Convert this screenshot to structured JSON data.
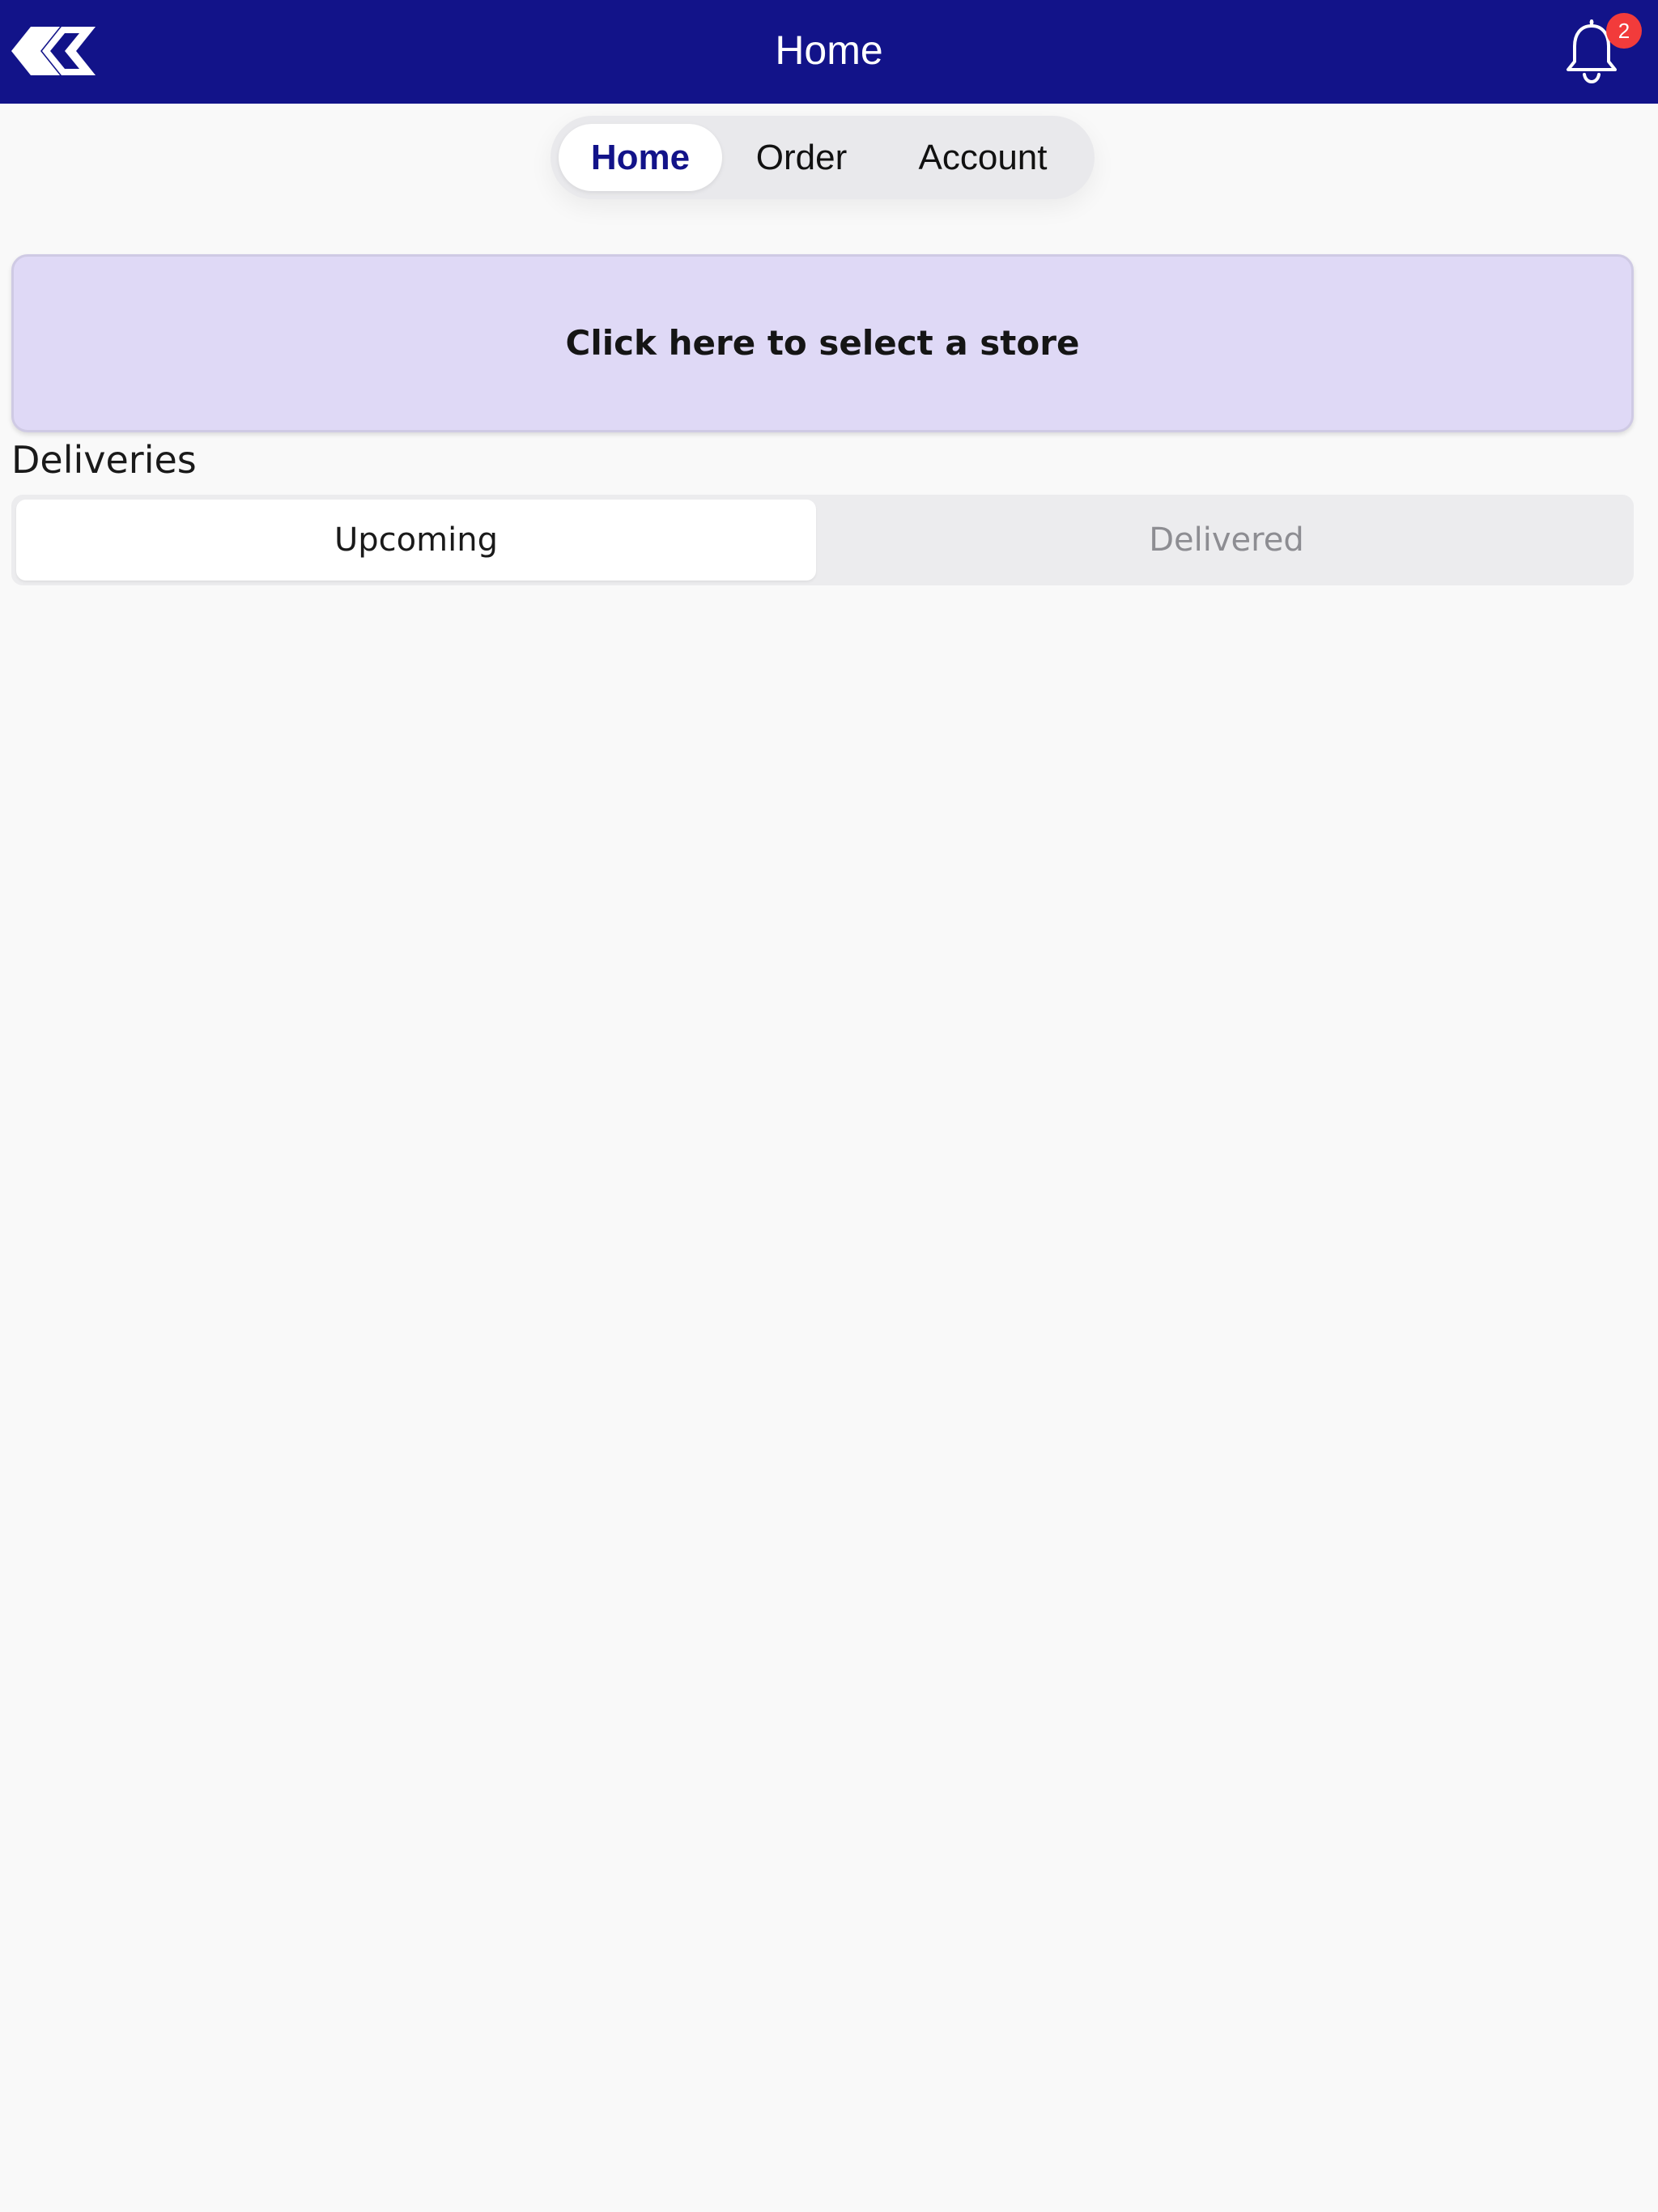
{
  "header": {
    "title": "Home",
    "logo_icon": "logo-icon",
    "bell_icon": "bell-icon",
    "notification_count": "2",
    "background_color": "#121389",
    "badge_color": "#f23b3b"
  },
  "nav_tabs": {
    "items": [
      {
        "label": "Home",
        "selected": true
      },
      {
        "label": "Order",
        "selected": false
      },
      {
        "label": "Account",
        "selected": false
      }
    ],
    "selected_color": "#121389"
  },
  "store_selector": {
    "label": "Click here to select a store",
    "background_color": "#dfd9f6"
  },
  "deliveries": {
    "title": "Deliveries",
    "segments": [
      {
        "label": "Upcoming",
        "selected": true
      },
      {
        "label": "Delivered",
        "selected": false
      }
    ]
  }
}
